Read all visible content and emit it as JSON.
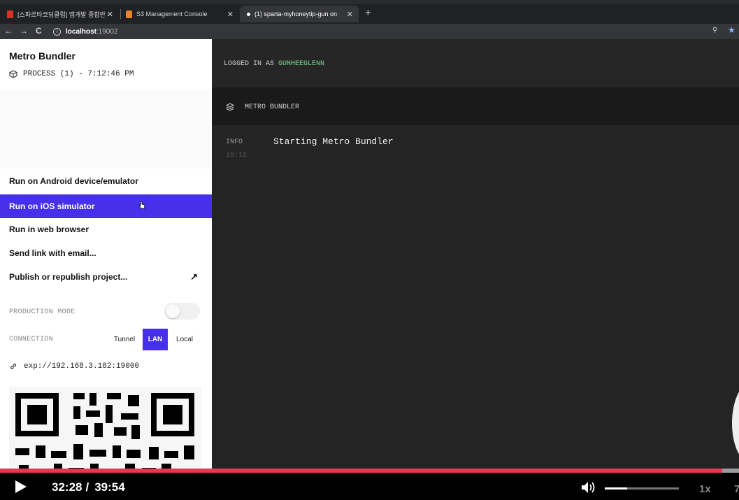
{
  "browser": {
    "tabs": [
      {
        "title": "[스파르타코딩클럽] 앱개발 종합반 -",
        "favicon_color": "#d93025",
        "active": false
      },
      {
        "title": "S3 Management Console",
        "favicon_color": "#e8832a",
        "active": false
      },
      {
        "title": "(1) sparta-myhoneytip-gun on",
        "favicon_color": "#ffffff",
        "active": true
      }
    ],
    "close_glyph": "✕",
    "new_tab_glyph": "+",
    "address": {
      "host": "localhost",
      "port": ":19002"
    }
  },
  "left_panel": {
    "title": "Metro Bundler",
    "process": "PROCESS (1) - 7:12:46 PM",
    "menu": [
      {
        "label": "Run on Android device/emulator",
        "selected": false
      },
      {
        "label": "Run on iOS simulator",
        "selected": true
      },
      {
        "label": "Run in web browser",
        "selected": false
      },
      {
        "label": "Send link with email...",
        "selected": false
      },
      {
        "label": "Publish or republish project...",
        "selected": false,
        "icon": "external-arrow-icon"
      }
    ],
    "production_mode_label": "PRODUCTION MODE",
    "production_mode_on": false,
    "connection_label": "CONNECTION",
    "connection_options": [
      "Tunnel",
      "LAN",
      "Local"
    ],
    "connection_selected": "LAN",
    "url": "exp://192.168.3.182:19000",
    "accent_color": "#4630eb"
  },
  "right_panel": {
    "logged_in_prefix": "LOGGED IN AS",
    "username": "GUNHEEGLENN",
    "section_title": "METRO BUNDLER",
    "log": {
      "level": "INFO",
      "time": "19:12",
      "message": "Starting Metro Bundler"
    }
  },
  "video": {
    "current_time": "32:28",
    "time_separator": "/",
    "duration": "39:54",
    "progress_fraction": 0.977,
    "volume_fraction": 0.3,
    "speed": "1x",
    "trailing_char": "7",
    "progress_color": "#e53950"
  }
}
